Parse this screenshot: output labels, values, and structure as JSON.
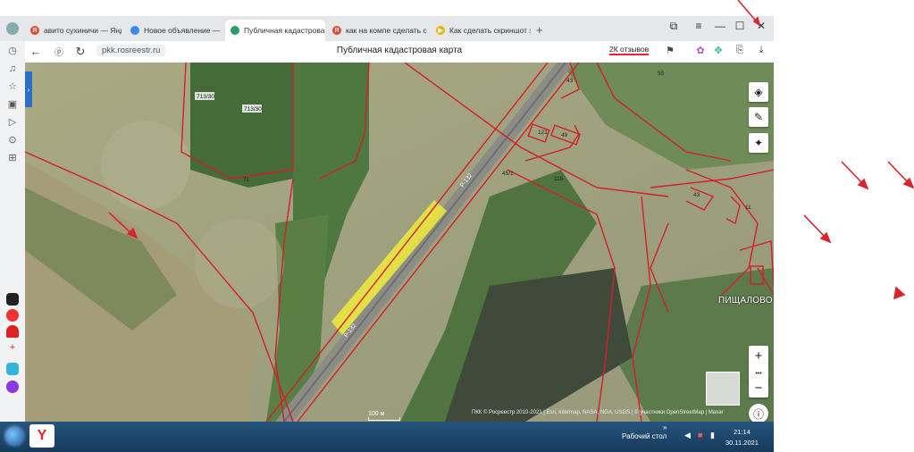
{
  "tabs": [
    {
      "label": "авито сухиничи — Яндекс",
      "favicon": "yandex-icon",
      "color": "#e8452c"
    },
    {
      "label": "Новое объявление — ОС",
      "favicon": "avito-icon",
      "color": "#3a8be6"
    },
    {
      "label": "Публичная кадастровая",
      "favicon": "rosreestr-icon",
      "color": "#2a9d6c",
      "active": true
    },
    {
      "label": "как на компе сделать скр",
      "favicon": "yandex-icon",
      "color": "#e8452c"
    },
    {
      "label": "Как сделать скриншот эк",
      "favicon": "youtube-icon",
      "color": "#f0b400"
    }
  ],
  "tab_close": "×",
  "new_tab": "+",
  "window_controls": {
    "minimize": "—",
    "maximize": "☐",
    "close": "✕"
  },
  "address": {
    "url": "pkk.rosreestr.ru",
    "page_title": "Публичная кадастровая карта",
    "reviews": "2К отзывов"
  },
  "map": {
    "village": "ПИЩАЛОВО",
    "road_label": "Р-132",
    "scale": "100 м",
    "copyright": "ПКК © Росреестр 2010-2021 | Esri, Intermap, NASA, NGA, USGS | © участники OpenStreetMap | Maxar",
    "parcels": [
      "713/30",
      "713/30",
      "71",
      "45/1",
      "115",
      "121",
      "49",
      "43",
      "55",
      "43",
      "11"
    ],
    "highlight_color": "#f2ee3a",
    "boundary_color": "#d31f2a",
    "zoom_in": "+",
    "zoom_more": "•••",
    "zoom_out": "−"
  },
  "taskbar": {
    "desktop_label": "Рабочий стол",
    "time": "21:14",
    "date": "30.11.2021",
    "yandex_label": "Y"
  }
}
